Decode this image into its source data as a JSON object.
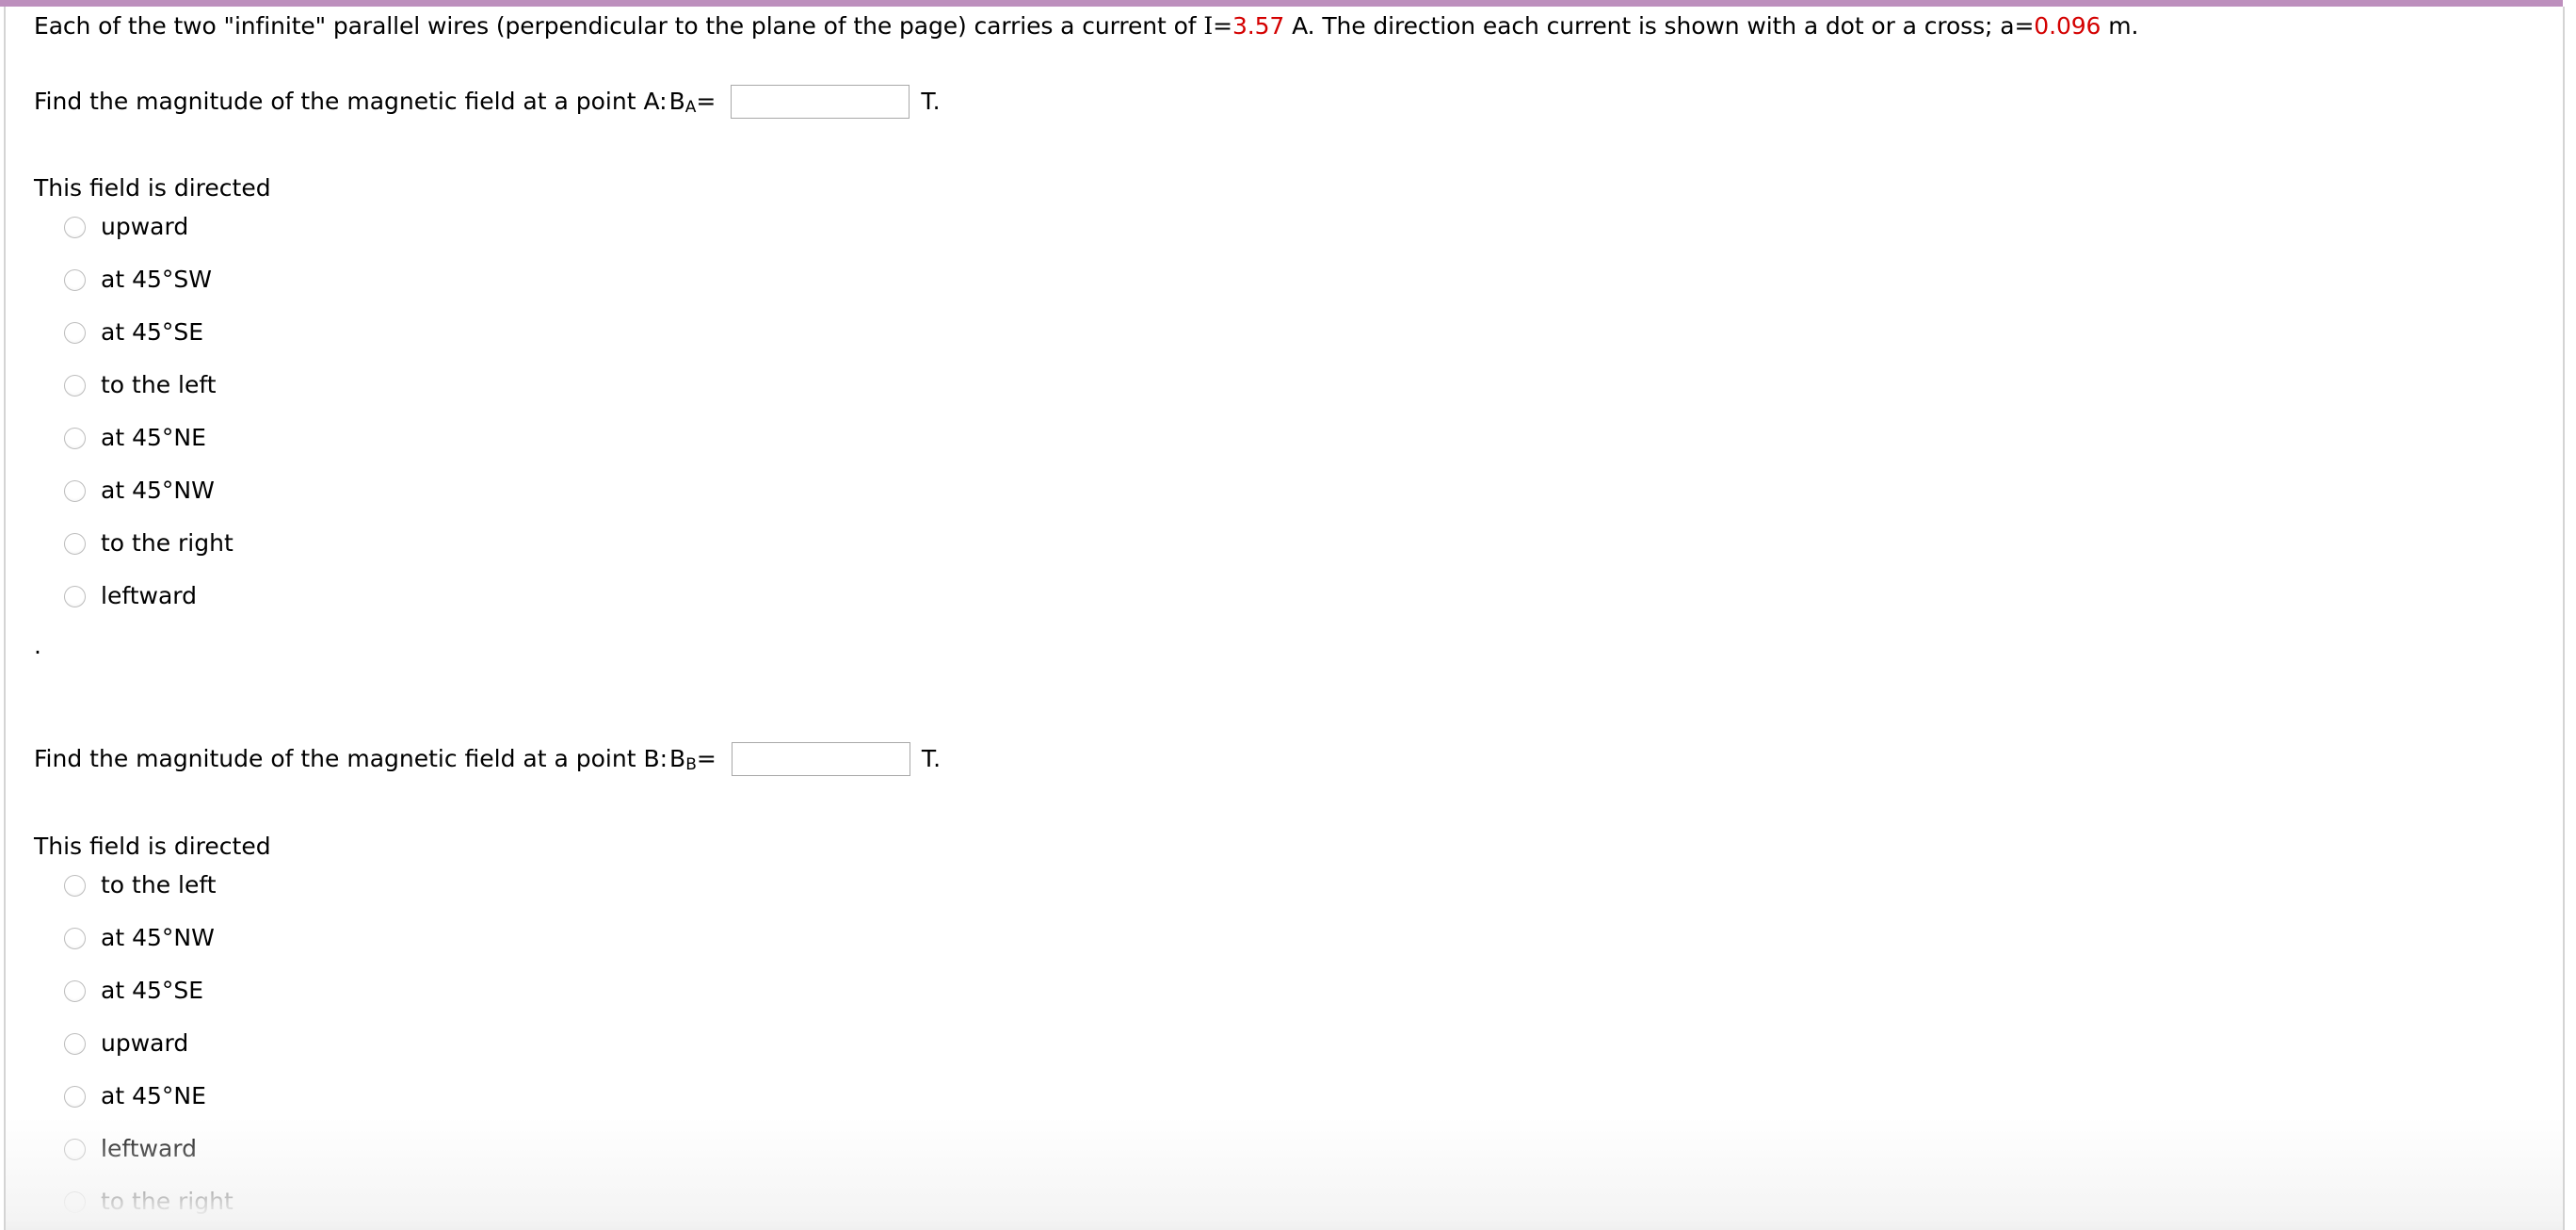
{
  "page": {
    "accent_color": "#bd8fbd",
    "highlight_value_color": "#d40000",
    "border_color": "#d4d4d4"
  },
  "problem": {
    "intro_part1": "Each of the two \"infinite\" parallel wires (perpendicular to the plane of the page) carries a current of ",
    "intro_current_label": "I=",
    "intro_current_value": "3.57",
    "intro_part2": " A. The direction each current is shown with a dot or a cross; ",
    "intro_a_label": "a=",
    "intro_a_value": "0.096",
    "intro_part3": " m.",
    "stray_period": "."
  },
  "question_a": {
    "prompt": "Find the magnitude of the magnetic field at a point A: ",
    "variable_base": "B",
    "variable_sub": "A",
    "equals": "=",
    "input_value": "",
    "input_placeholder": "",
    "unit": "T.",
    "directed_label": "This field is directed",
    "options": [
      {
        "label": "upward",
        "selected": false
      },
      {
        "label": "at 45°SW",
        "selected": false
      },
      {
        "label": "at 45°SE",
        "selected": false
      },
      {
        "label": "to the left",
        "selected": false
      },
      {
        "label": "at 45°NE",
        "selected": false
      },
      {
        "label": "at 45°NW",
        "selected": false
      },
      {
        "label": "to the right",
        "selected": false
      },
      {
        "label": "leftward",
        "selected": false
      }
    ]
  },
  "question_b": {
    "prompt": "Find the magnitude of the magnetic field at a point B: ",
    "variable_base": "B",
    "variable_sub": "B",
    "equals": "=",
    "input_value": "",
    "input_placeholder": "",
    "unit": "T.",
    "directed_label": "This field is directed",
    "options": [
      {
        "label": "to the left",
        "selected": false
      },
      {
        "label": "at 45°NW",
        "selected": false
      },
      {
        "label": "at 45°SE",
        "selected": false
      },
      {
        "label": "upward",
        "selected": false
      },
      {
        "label": "at 45°NE",
        "selected": false
      },
      {
        "label": "leftward",
        "selected": false
      },
      {
        "label": "to the right",
        "selected": false
      }
    ]
  }
}
